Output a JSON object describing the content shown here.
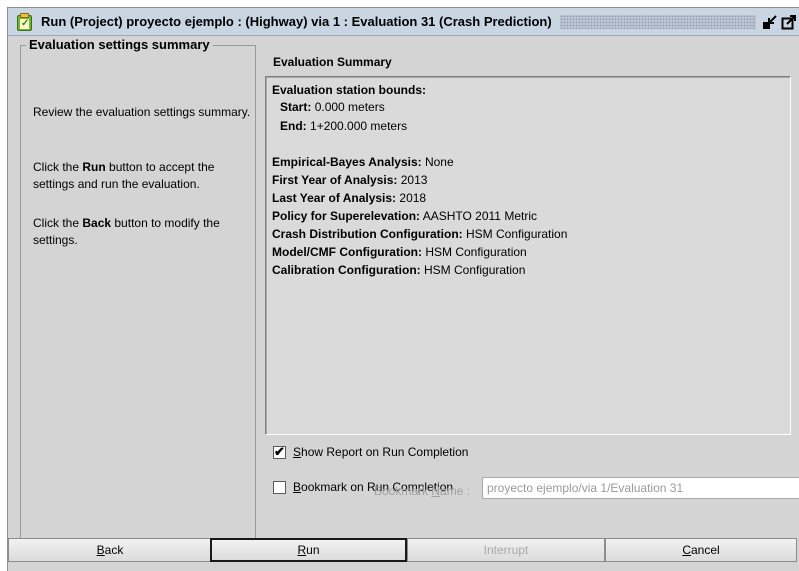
{
  "window": {
    "title": "Run (Project) proyecto ejemplo : (Highway) via 1 : Evaluation 31 (Crash Prediction)",
    "icons": [
      "clipboard-check-icon",
      "minimize-icon",
      "maximize-icon"
    ]
  },
  "left_panel": {
    "heading": "Evaluation settings summary",
    "para1": "Review the evaluation settings summary.",
    "para2_pre": "Click the ",
    "para2_bold": "Run",
    "para2_post": " button to accept the settings and run the evaluation.",
    "para3_pre": "Click the ",
    "para3_bold": "Back",
    "para3_post": " button to modify the settings."
  },
  "summary": {
    "header": "Evaluation Summary",
    "bounds_label": "Evaluation station bounds:",
    "start_label": "Start:",
    "start_value": "0.000 meters",
    "end_label": "End:",
    "end_value": "1+200.000 meters",
    "rows": [
      {
        "label": "Empirical-Bayes Analysis:",
        "value": "None"
      },
      {
        "label": "First Year of Analysis:",
        "value": "2013"
      },
      {
        "label": "Last Year of Analysis:",
        "value": "2018"
      },
      {
        "label": "Policy for Superelevation:",
        "value": "AASHTO 2011 Metric"
      },
      {
        "label": "Crash Distribution Configuration:",
        "value": "HSM Configuration"
      },
      {
        "label": "Model/CMF Configuration:",
        "value": "HSM Configuration"
      },
      {
        "label": "Calibration Configuration:",
        "value": "HSM Configuration"
      }
    ]
  },
  "options": {
    "show_report": {
      "mn": "S",
      "rest": "how Report on Run Completion",
      "checked": true
    },
    "bookmark": {
      "mn": "B",
      "rest": "ookmark on Run Completion",
      "checked": false
    },
    "bookmark_name_label_pre": "Bookmark ",
    "bookmark_name_label_mn": "N",
    "bookmark_name_label_post": "ame :",
    "bookmark_name_value": "proyecto ejemplo/via 1/Evaluation 31"
  },
  "buttons": {
    "back": {
      "mn": "B",
      "rest": "ack"
    },
    "run": {
      "mn": "R",
      "rest": "un"
    },
    "interrupt": {
      "label": "Interrupt"
    },
    "cancel": {
      "mn": "C",
      "rest": "ancel"
    }
  },
  "colors": {
    "titlebar": "#cad5e3",
    "dialog_bg": "#d4d4d4",
    "disabled_text": "#a8a8a8"
  }
}
